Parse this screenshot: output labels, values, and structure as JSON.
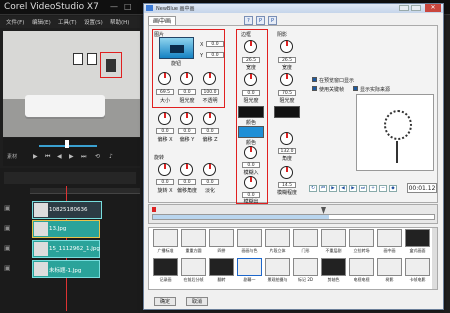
{
  "app": {
    "title": "Corel VideoStudio X7",
    "menu": [
      "文件(F)",
      "编辑(E)",
      "工具(T)",
      "设置(S)",
      "帮助(H)"
    ],
    "tl_time": "1",
    "scrub_label": "素材"
  },
  "timeline": {
    "clips": [
      {
        "label": "10825180636"
      },
      {
        "label": "13.Jpg"
      },
      {
        "label": "15_1112962_1.Jpg"
      },
      {
        "label": "未标题-1.Jpg"
      }
    ]
  },
  "dialog": {
    "title": "NewBlue 画中画",
    "tab": "画中画",
    "toolbar_buttons": [
      "?",
      "P",
      "P"
    ],
    "sections": {
      "image": "图片",
      "border": "边框",
      "shadow": "阴影",
      "rotate": "旋转"
    },
    "image": {
      "pos_x": "0.0",
      "pos_y": "0.0",
      "pos_x_label": "X",
      "pos_y_label": "Y",
      "center_label": "旋钮",
      "size": "69.5",
      "size_label": "大小",
      "opacity": "100.0",
      "opacity_label": "不透明",
      "transparency": "0.0",
      "transparency_label": "阻光度",
      "skew_x": "0.0",
      "skew_x_label": "偏移 X",
      "skew_y": "0.0",
      "skew_y_label": "偏移 Y",
      "skew_z": "0.0",
      "skew_z_label": "偏移 Z",
      "rot_x": "0.0",
      "rot_x_label": "旋转 X",
      "rot_y": "0.0",
      "rot_y_label": "偏移角度",
      "rot_z": "0.0",
      "rot_z_label": "淡化"
    },
    "border": {
      "width": "26.5",
      "width_label": "宽度",
      "opacity": "0.0",
      "opacity_label": "阻光度",
      "color_label": "颜色",
      "color2_label": "颜色",
      "blur_in": "0.0",
      "blur_in_label": "模糊入",
      "blur_out": "0.0",
      "blur_out_label": "模糊出"
    },
    "shadow": {
      "width": "26.5",
      "width_label": "宽度",
      "opacity": "70.5",
      "opacity_label": "阻光度",
      "angle": "132.0",
      "angle_label": "角度",
      "blur": "14.5",
      "blur_label": "模糊程度"
    },
    "options": [
      {
        "label": "在预览窗口显示",
        "checked": true
      },
      {
        "label": "使用关键帧",
        "checked": true
      },
      {
        "label": "显示实际来源",
        "checked": true
      }
    ],
    "timecode": "00:01.12",
    "presets": [
      "广播标准",
      "重重方圆",
      "四拼",
      "画画与色",
      "片段立体",
      "门形",
      "不重层剧",
      "立拉转场",
      "画中画",
      "盒式画面",
      "记录画",
      "在前后分帧",
      "翻转",
      "剧幕一",
      "景观拍摄与",
      "标记 2D",
      "剪轴色",
      "电视电视",
      "树影",
      "卡帧电影",
      "Web 2.0"
    ],
    "ok_label": "确定",
    "cancel_label": "取消"
  }
}
